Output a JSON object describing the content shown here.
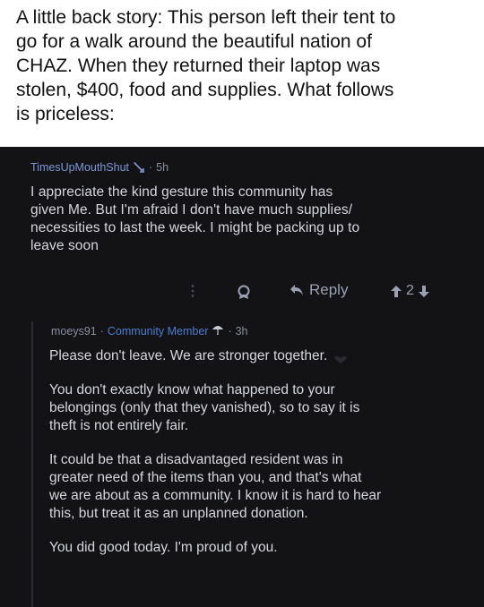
{
  "caption": {
    "lines": [
      "A little back story: This person left their tent to",
      "go for a walk around the beautiful nation of",
      "CHAZ. When they returned their laptop was",
      "stolen, $400, food and supplies. What follows",
      "is priceless:"
    ]
  },
  "post": {
    "username": "TimesUpMouthShut",
    "separator": "·",
    "age": "5h",
    "body_lines": [
      "I appreciate the kind gesture this community has",
      "given Me. But I'm afraid I don't have much supplies/",
      "necessities to last the week. I might be packing up to",
      "leave soon"
    ],
    "actions": {
      "more": "⋮",
      "reply_label": "Reply",
      "vote_count": "2"
    }
  },
  "reply": {
    "username": "moeys91",
    "separator": "·",
    "flair": "Community Member",
    "age": "3h",
    "paragraphs": [
      [
        "Please don't leave. We are stronger together."
      ],
      [
        "You don't exactly know what happened to your",
        "belongings (only that they vanished), so to say it is",
        "theft is not entirely fair."
      ],
      [
        "It could be that a disadvantaged resident was in",
        "greater need of the items than you, and that's what",
        "we are about as a community. I know it is hard to hear",
        "this, but treat it as an unplanned donation."
      ],
      [
        "You did good today. I'm proud of you."
      ]
    ]
  },
  "colors": {
    "background": "#131316",
    "username": "#7e98d6",
    "flair": "#4b7fd0",
    "text": "#d6d7dc"
  },
  "icons": {
    "mod": "sword-icon",
    "award": "award-icon",
    "reply": "reply-arrow-icon",
    "upvote": "upvote-arrow-icon",
    "downvote": "downvote-arrow-icon",
    "flair_emoji": "umbrella-icon",
    "heart": "heart-icon"
  }
}
